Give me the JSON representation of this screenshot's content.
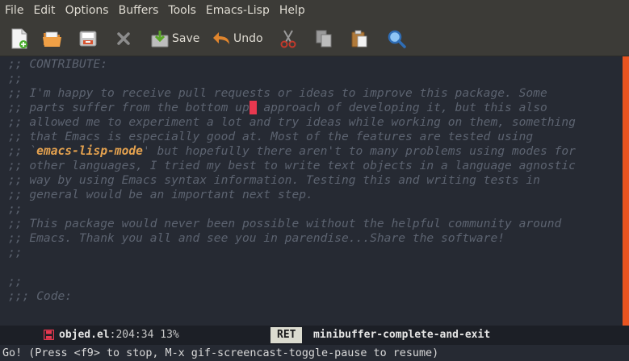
{
  "menubar": {
    "items": [
      "File",
      "Edit",
      "Options",
      "Buffers",
      "Tools",
      "Emacs-Lisp",
      "Help"
    ]
  },
  "toolbar": {
    "save_label": "Save",
    "undo_label": "Undo",
    "icons": [
      "new-file-icon",
      "open-folder-icon",
      "save-disk-icon",
      "close-icon",
      "save-icon",
      "undo-icon",
      "cut-icon",
      "copy-icon",
      "paste-icon",
      "search-icon"
    ]
  },
  "editor": {
    "lines": [
      ";; CONTRIBUTE:",
      ";;",
      ";; I'm happy to receive pull requests or ideas to improve this package. Some",
      ";; parts suffer from the bottom up",
      " approach of developing it, but this also",
      ";; allowed me to experiment a lot and try ideas while working on them, something",
      ";; that Emacs is especially good at. Most of the features are tested using",
      ";; `",
      "emacs-lisp-mode",
      "' but hopefully there aren't to many problems using modes for",
      ";; other languages, I tried my best to write text objects in a language agnostic",
      ";; way by using Emacs syntax information. Testing this and writing tests in",
      ";; general would be an important next step.",
      ";;",
      ";; This package would never been possible without the helpful community around",
      ";; Emacs. Thank you all and see you in parendise...Share the software!",
      ";;",
      "",
      ";;",
      ";;; Code:"
    ],
    "cursor_char": " "
  },
  "modeline": {
    "buffer_name": "objed.el",
    "position": ":204:34 13%",
    "key": "RET",
    "command": "minibuffer-complete-and-exit"
  },
  "echo_area": "Go! (Press <f9> to stop, M-x gif-screencast-toggle-pause to resume)",
  "colors": {
    "background": "#262a33",
    "comment": "#5c6370",
    "keyword": "#e5a24f",
    "cursor": "#e8384f",
    "scrollbar": "#e95420",
    "toolbar": "#3c3b37"
  }
}
